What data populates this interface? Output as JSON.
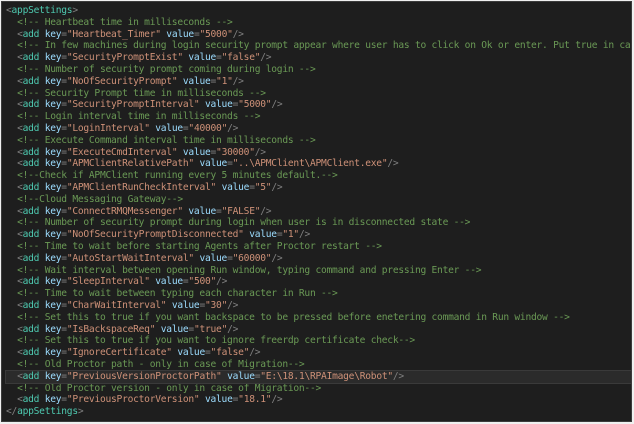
{
  "editor": {
    "lines": [
      {
        "indent": 0,
        "kind": "open",
        "tag": "appSettings"
      },
      {
        "indent": 1,
        "kind": "comment",
        "text": "Heartbeat time in milliseconds"
      },
      {
        "indent": 1,
        "kind": "add",
        "key": "Heartbeat_Timer",
        "value": "5000"
      },
      {
        "indent": 1,
        "kind": "comment",
        "text": "In few machines during login security prompt appear where user has to click on Ok or enter. Put true in case security"
      },
      {
        "indent": 1,
        "kind": "add",
        "key": "SecurityPromptExist",
        "value": "false"
      },
      {
        "indent": 1,
        "kind": "comment",
        "text": "Number of security prompt coming during login"
      },
      {
        "indent": 1,
        "kind": "add",
        "key": "NoOfSecurityPrompt",
        "value": "1"
      },
      {
        "indent": 1,
        "kind": "comment",
        "text": "Security Prompt time in milliseconds"
      },
      {
        "indent": 1,
        "kind": "add",
        "key": "SecurityPromptInterval",
        "value": "5000"
      },
      {
        "indent": 1,
        "kind": "comment",
        "text": "Login interval time in milliseconds"
      },
      {
        "indent": 1,
        "kind": "add",
        "key": "LoginInterval",
        "value": "40000"
      },
      {
        "indent": 1,
        "kind": "comment",
        "text": "Execute Command interval time in milliseconds"
      },
      {
        "indent": 1,
        "kind": "add",
        "key": "ExecuteCmdInterval",
        "value": "30000"
      },
      {
        "indent": 1,
        "kind": "add",
        "key": "APMClientRelativePath",
        "value": "..\\APMClient\\APMClient.exe"
      },
      {
        "indent": 1,
        "kind": "comment_tight",
        "text": "Check if APMClient running every 5 minutes default."
      },
      {
        "indent": 1,
        "kind": "add",
        "key": "APMClientRunCheckInterval",
        "value": "5"
      },
      {
        "indent": 1,
        "kind": "comment_tight",
        "text": "Cloud Messaging Gateway"
      },
      {
        "indent": 1,
        "kind": "add",
        "key": "ConnectRMQMessenger",
        "value": "FALSE"
      },
      {
        "indent": 1,
        "kind": "comment",
        "text": "Number of security prompt during login when user is in disconnected state"
      },
      {
        "indent": 1,
        "kind": "add",
        "key": "NoOfSecurityPromptDisconnected",
        "value": "1"
      },
      {
        "indent": 1,
        "kind": "comment",
        "text": "Time to wait before starting Agents after Proctor restart"
      },
      {
        "indent": 1,
        "kind": "add",
        "key": "AutoStartWaitInterval",
        "value": "60000"
      },
      {
        "indent": 1,
        "kind": "comment",
        "text": "Wait interval between opening Run window, typing command and pressing Enter"
      },
      {
        "indent": 1,
        "kind": "add",
        "key": "SleepInterval",
        "value": "500"
      },
      {
        "indent": 1,
        "kind": "comment",
        "text": "Time to wait between typing each character in Run"
      },
      {
        "indent": 1,
        "kind": "add",
        "key": "CharWaitInterval",
        "value": "30",
        "caret": true
      },
      {
        "indent": 1,
        "kind": "comment",
        "text": "Set this to true if you want backspace to be pressed before enetering command in Run window"
      },
      {
        "indent": 1,
        "kind": "add",
        "key": "IsBackspaceReq",
        "value": "true"
      },
      {
        "indent": 1,
        "kind": "comment",
        "text": "Set this to true if you want to ignore freerdp certificate check",
        "tail": "-->"
      },
      {
        "indent": 1,
        "kind": "add",
        "key": "IgnoreCertificate",
        "value": "false"
      },
      {
        "indent": 1,
        "kind": "comment",
        "text": "Old Proctor path - only in case of Migration",
        "tail": "-->"
      },
      {
        "indent": 1,
        "kind": "add",
        "key": "PreviousVersionProctorPath",
        "value": "E:\\18.1\\RPAImage\\Robot",
        "highlight": true
      },
      {
        "indent": 1,
        "kind": "comment",
        "text": "Old Proctor version - only in case of Migration",
        "tail": "-->"
      },
      {
        "indent": 1,
        "kind": "add",
        "key": "PreviousProctorVersion",
        "value": "18.1"
      },
      {
        "indent": 0,
        "kind": "close",
        "tag": "appSettings"
      }
    ]
  }
}
